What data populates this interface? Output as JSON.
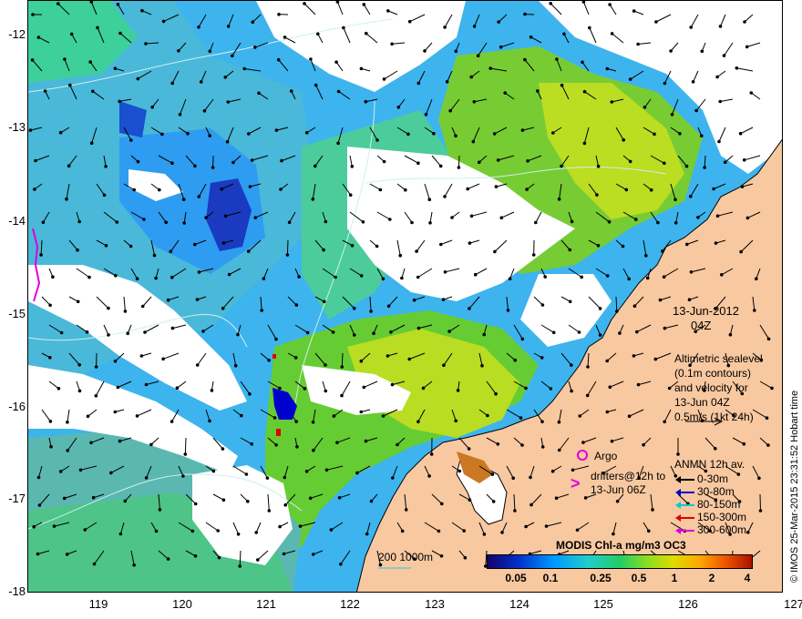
{
  "map": {
    "y_ticks": [
      "-12",
      "-13",
      "-14",
      "-15",
      "-16",
      "-17",
      "-18"
    ],
    "x_ticks": [
      "119",
      "120",
      "121",
      "122",
      "123",
      "124",
      "125",
      "126",
      "127"
    ],
    "date": "13-Jun-2012",
    "time": "04Z",
    "altimetry_note": [
      "Altimetric sealevel",
      "(0.1m contours)",
      "and velocity for",
      "13-Jun 04Z",
      "0.5m/s (1kt 24h)"
    ],
    "argo_label": "Argo",
    "drifters_label": [
      "drifters@12h to",
      "13-Jun 06Z"
    ],
    "anmn_title": "ANMN 12h av.",
    "anmn_items": [
      {
        "label": "0-30m",
        "color": "#000000"
      },
      {
        "label": "30-80m",
        "color": "#0000cc"
      },
      {
        "label": "80-150m",
        "color": "#00cccc"
      },
      {
        "label": "150-300m",
        "color": "#dd0000"
      },
      {
        "label": "300-600m",
        "color": "#dd00dd"
      }
    ],
    "isobath_label": "200  1000m",
    "colorbar_title": "MODIS Chl-a mg/m3 OC3",
    "colorbar_ticks": [
      "0.05",
      "0.1",
      "0.25",
      "0.5",
      "1",
      "2",
      "4"
    ],
    "credit": "© IMOS 25-Mar-2015 23:31:52 Hobart time",
    "colors": {
      "land": "#f8c8a0",
      "ocean_low": "#2aa0ff",
      "ocean_mid": "#44cc77",
      "ocean_high": "#ccdd22",
      "cloud": "#ffffff"
    }
  }
}
